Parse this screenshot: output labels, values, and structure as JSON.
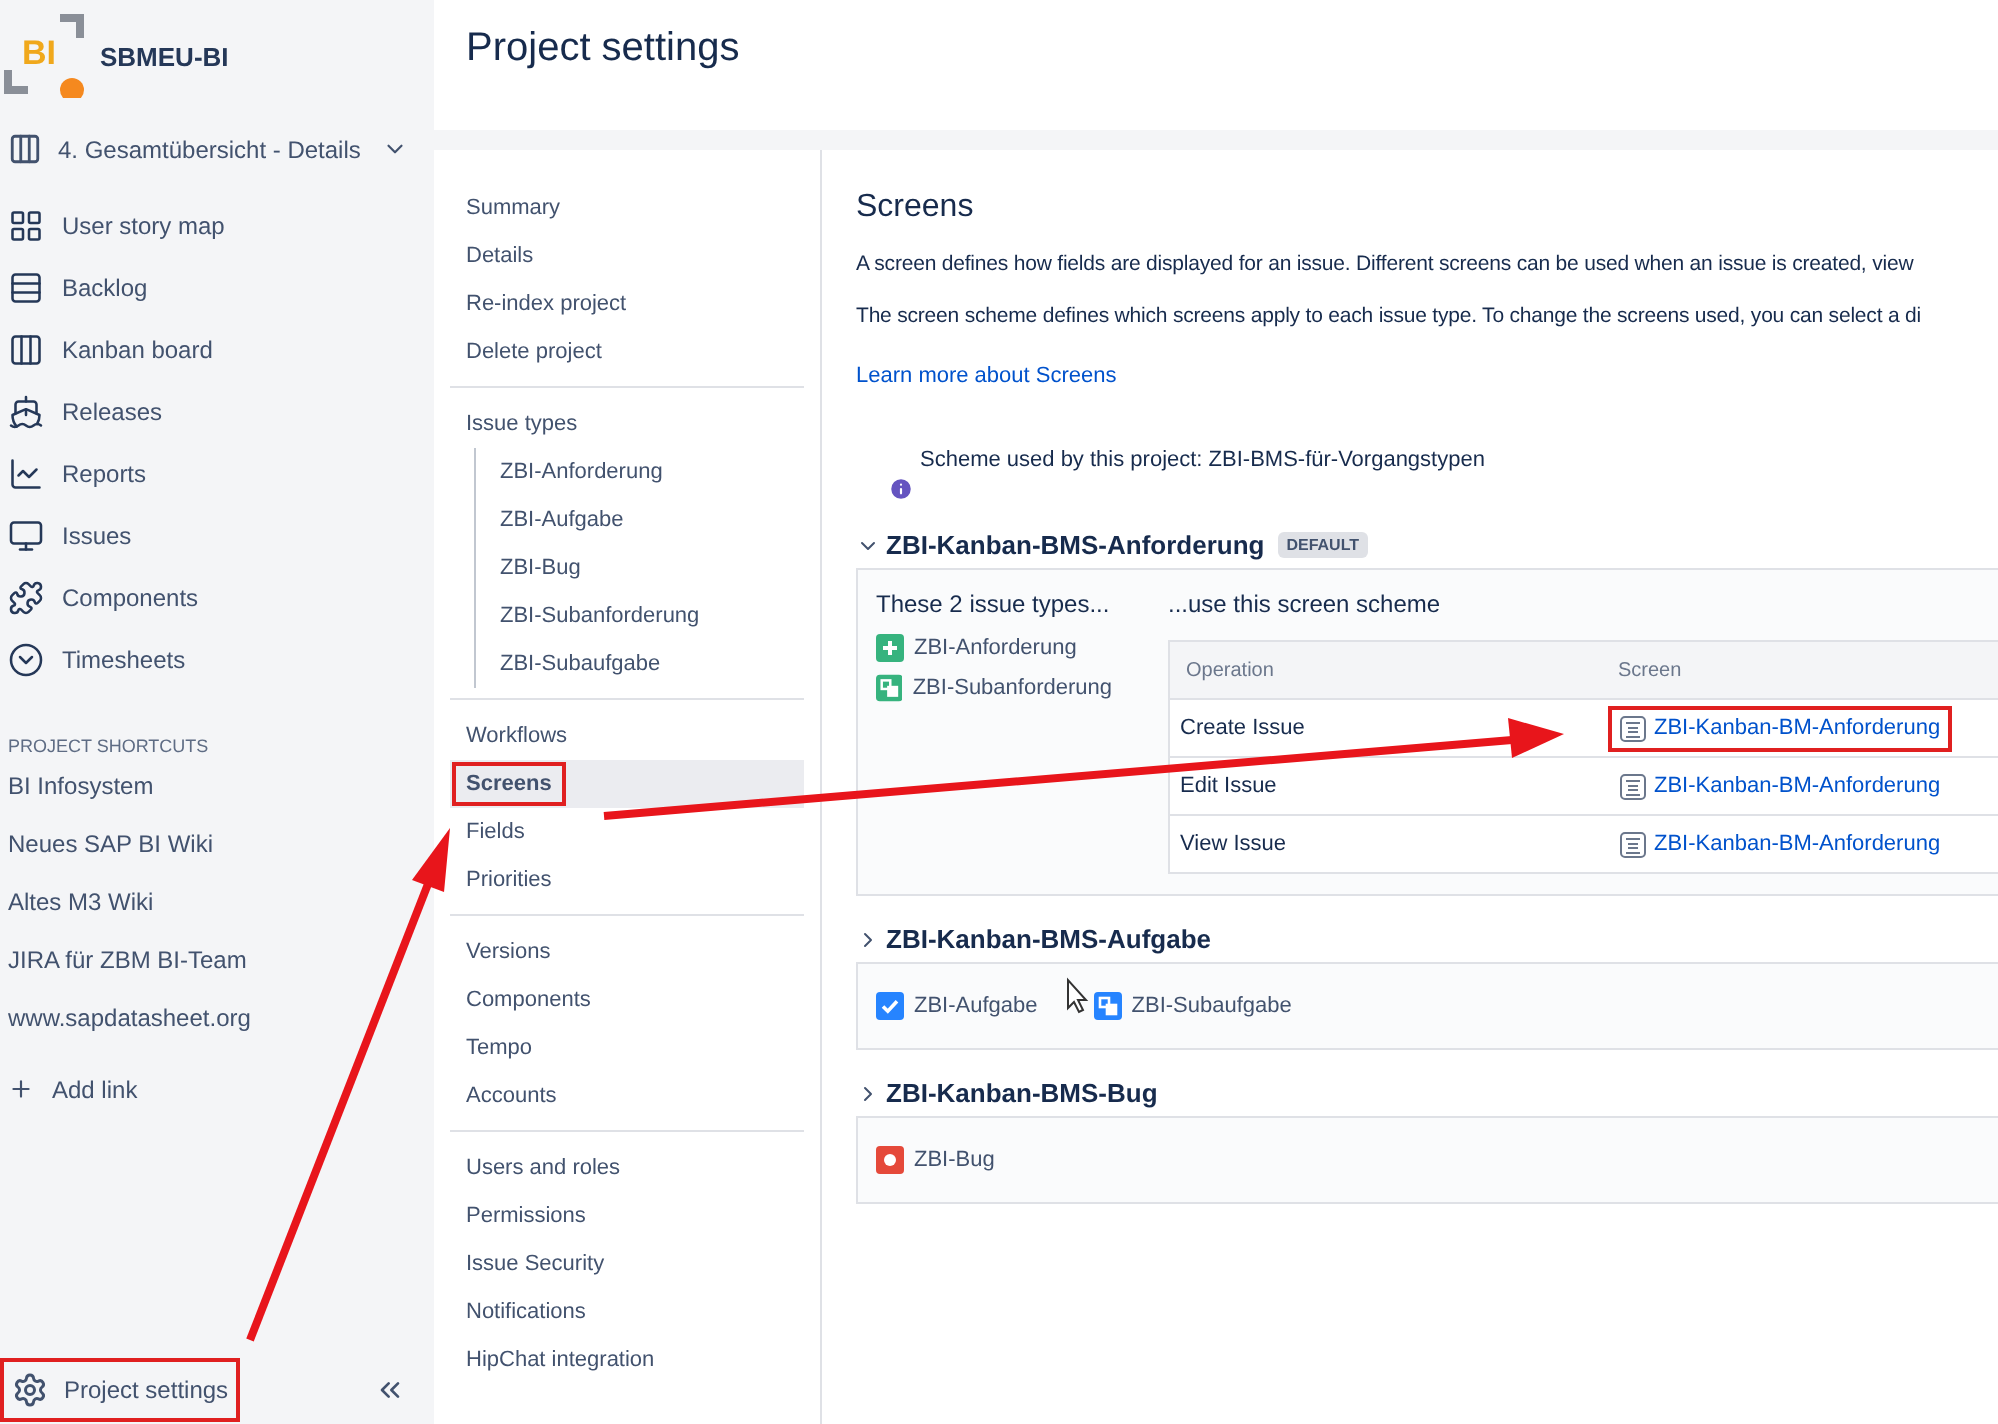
{
  "project": {
    "name": "SBMEU-BI",
    "logo_text": "BI"
  },
  "board_selector": {
    "label": "4. Gesamtübersicht - Details"
  },
  "sidebar": {
    "items": [
      {
        "label": "User story map",
        "kind": "storymap"
      },
      {
        "label": "Backlog",
        "kind": "backlog"
      },
      {
        "label": "Kanban board",
        "kind": "board"
      },
      {
        "label": "Releases",
        "kind": "releases"
      },
      {
        "label": "Reports",
        "kind": "reports"
      },
      {
        "label": "Issues",
        "kind": "issues"
      },
      {
        "label": "Components",
        "kind": "components"
      },
      {
        "label": "Timesheets",
        "kind": "timesheets"
      }
    ]
  },
  "shortcuts": {
    "title": "PROJECT SHORTCUTS",
    "items": [
      "BI Infosystem",
      "Neues SAP BI Wiki",
      "Altes M3 Wiki",
      "JIRA für ZBM BI-Team",
      "www.sapdatasheet.org"
    ],
    "add_link": "Add link"
  },
  "project_settings": {
    "label": "Project settings",
    "highlighted": true
  },
  "header": {
    "title": "Project settings"
  },
  "settings_nav": {
    "groups": [
      {
        "items": [
          {
            "label": "Summary",
            "selected": false,
            "highlighted": false
          },
          {
            "label": "Details",
            "selected": false,
            "highlighted": false
          },
          {
            "label": "Re-index project",
            "selected": false,
            "highlighted": false
          },
          {
            "label": "Delete project",
            "selected": false,
            "highlighted": false
          }
        ]
      },
      {
        "items": [
          {
            "label": "Issue types",
            "selected": false,
            "highlighted": false,
            "children": [
              {
                "label": "ZBI-Anforderung",
                "selected": false
              },
              {
                "label": "ZBI-Aufgabe",
                "selected": false
              },
              {
                "label": "ZBI-Bug",
                "selected": false
              },
              {
                "label": "ZBI-Subanforderung",
                "selected": false
              },
              {
                "label": "ZBI-Subaufgabe",
                "selected": false
              }
            ]
          }
        ]
      },
      {
        "items": [
          {
            "label": "Workflows",
            "selected": false,
            "highlighted": false
          },
          {
            "label": "Screens",
            "selected": true,
            "highlighted": true
          },
          {
            "label": "Fields",
            "selected": false,
            "highlighted": false
          },
          {
            "label": "Priorities",
            "selected": false,
            "highlighted": false
          }
        ]
      },
      {
        "items": [
          {
            "label": "Versions",
            "selected": false,
            "highlighted": false
          },
          {
            "label": "Components",
            "selected": false,
            "highlighted": false
          },
          {
            "label": "Tempo",
            "selected": false,
            "highlighted": false
          },
          {
            "label": "Accounts",
            "selected": false,
            "highlighted": false
          }
        ]
      },
      {
        "items": [
          {
            "label": "Users and roles",
            "selected": false,
            "highlighted": false
          },
          {
            "label": "Permissions",
            "selected": false,
            "highlighted": false
          },
          {
            "label": "Issue Security",
            "selected": false,
            "highlighted": false
          },
          {
            "label": "Notifications",
            "selected": false,
            "highlighted": false
          },
          {
            "label": "HipChat integration",
            "selected": false,
            "highlighted": false
          }
        ]
      }
    ]
  },
  "screens": {
    "title": "Screens",
    "paragraphs": [
      "A screen defines how fields are displayed for an issue. Different screens can be used when an issue is created, view",
      "The screen scheme defines which screens apply to each issue type. To change the screens used, you can select a di"
    ],
    "learn_more": "Learn more about Screens",
    "scheme_info": "Scheme used by this project: ZBI-BMS-für-Vorgangstypen",
    "schemes": [
      {
        "name": "ZBI-Kanban-BMS-Anforderung",
        "expanded": true,
        "badge": "DEFAULT",
        "types_heading": "These 2 issue types...",
        "scheme_heading": "...use this screen scheme",
        "issue_types": [
          {
            "name": "ZBI-Anforderung",
            "kind": "plus",
            "color": "#36b37e"
          },
          {
            "name": "ZBI-Subanforderung",
            "kind": "subtask",
            "color": "#36b37e"
          }
        ],
        "columns": [
          "Operation",
          "Screen"
        ],
        "rows": [
          {
            "operation": "Create Issue",
            "screen": "ZBI-Kanban-BM-Anforderung",
            "highlighted": true
          },
          {
            "operation": "Edit Issue",
            "screen": "ZBI-Kanban-BM-Anforderung",
            "highlighted": false
          },
          {
            "operation": "View Issue",
            "screen": "ZBI-Kanban-BM-Anforderung",
            "highlighted": false
          }
        ]
      },
      {
        "name": "ZBI-Kanban-BMS-Aufgabe",
        "expanded": false,
        "issue_types": [
          {
            "name": "ZBI-Aufgabe",
            "kind": "check",
            "color": "#2684ff"
          },
          {
            "name": "ZBI-Subaufgabe",
            "kind": "subtask",
            "color": "#2684ff"
          }
        ]
      },
      {
        "name": "ZBI-Kanban-BMS-Bug",
        "expanded": false,
        "issue_types": [
          {
            "name": "ZBI-Bug",
            "kind": "bug",
            "color": "#e5493a"
          }
        ]
      }
    ]
  }
}
